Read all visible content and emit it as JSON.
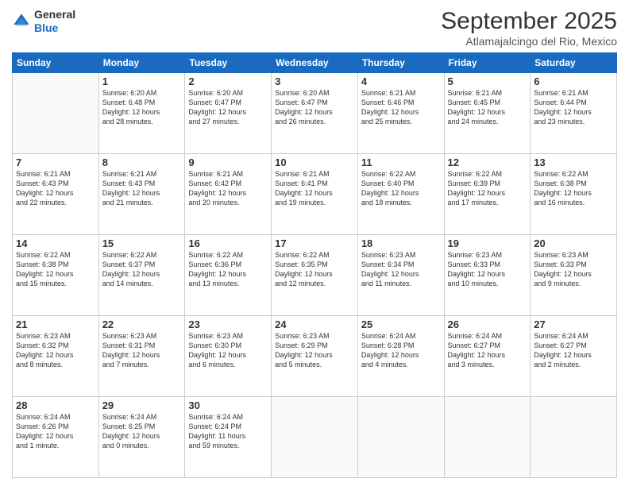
{
  "header": {
    "logo_line1": "General",
    "logo_line2": "Blue",
    "month_title": "September 2025",
    "subtitle": "Atlamajalcingo del Rio, Mexico"
  },
  "days_of_week": [
    "Sunday",
    "Monday",
    "Tuesday",
    "Wednesday",
    "Thursday",
    "Friday",
    "Saturday"
  ],
  "weeks": [
    [
      {
        "num": "",
        "info": ""
      },
      {
        "num": "1",
        "info": "Sunrise: 6:20 AM\nSunset: 6:48 PM\nDaylight: 12 hours\nand 28 minutes."
      },
      {
        "num": "2",
        "info": "Sunrise: 6:20 AM\nSunset: 6:47 PM\nDaylight: 12 hours\nand 27 minutes."
      },
      {
        "num": "3",
        "info": "Sunrise: 6:20 AM\nSunset: 6:47 PM\nDaylight: 12 hours\nand 26 minutes."
      },
      {
        "num": "4",
        "info": "Sunrise: 6:21 AM\nSunset: 6:46 PM\nDaylight: 12 hours\nand 25 minutes."
      },
      {
        "num": "5",
        "info": "Sunrise: 6:21 AM\nSunset: 6:45 PM\nDaylight: 12 hours\nand 24 minutes."
      },
      {
        "num": "6",
        "info": "Sunrise: 6:21 AM\nSunset: 6:44 PM\nDaylight: 12 hours\nand 23 minutes."
      }
    ],
    [
      {
        "num": "7",
        "info": "Sunrise: 6:21 AM\nSunset: 6:43 PM\nDaylight: 12 hours\nand 22 minutes."
      },
      {
        "num": "8",
        "info": "Sunrise: 6:21 AM\nSunset: 6:43 PM\nDaylight: 12 hours\nand 21 minutes."
      },
      {
        "num": "9",
        "info": "Sunrise: 6:21 AM\nSunset: 6:42 PM\nDaylight: 12 hours\nand 20 minutes."
      },
      {
        "num": "10",
        "info": "Sunrise: 6:21 AM\nSunset: 6:41 PM\nDaylight: 12 hours\nand 19 minutes."
      },
      {
        "num": "11",
        "info": "Sunrise: 6:22 AM\nSunset: 6:40 PM\nDaylight: 12 hours\nand 18 minutes."
      },
      {
        "num": "12",
        "info": "Sunrise: 6:22 AM\nSunset: 6:39 PM\nDaylight: 12 hours\nand 17 minutes."
      },
      {
        "num": "13",
        "info": "Sunrise: 6:22 AM\nSunset: 6:38 PM\nDaylight: 12 hours\nand 16 minutes."
      }
    ],
    [
      {
        "num": "14",
        "info": "Sunrise: 6:22 AM\nSunset: 6:38 PM\nDaylight: 12 hours\nand 15 minutes."
      },
      {
        "num": "15",
        "info": "Sunrise: 6:22 AM\nSunset: 6:37 PM\nDaylight: 12 hours\nand 14 minutes."
      },
      {
        "num": "16",
        "info": "Sunrise: 6:22 AM\nSunset: 6:36 PM\nDaylight: 12 hours\nand 13 minutes."
      },
      {
        "num": "17",
        "info": "Sunrise: 6:22 AM\nSunset: 6:35 PM\nDaylight: 12 hours\nand 12 minutes."
      },
      {
        "num": "18",
        "info": "Sunrise: 6:23 AM\nSunset: 6:34 PM\nDaylight: 12 hours\nand 11 minutes."
      },
      {
        "num": "19",
        "info": "Sunrise: 6:23 AM\nSunset: 6:33 PM\nDaylight: 12 hours\nand 10 minutes."
      },
      {
        "num": "20",
        "info": "Sunrise: 6:23 AM\nSunset: 6:33 PM\nDaylight: 12 hours\nand 9 minutes."
      }
    ],
    [
      {
        "num": "21",
        "info": "Sunrise: 6:23 AM\nSunset: 6:32 PM\nDaylight: 12 hours\nand 8 minutes."
      },
      {
        "num": "22",
        "info": "Sunrise: 6:23 AM\nSunset: 6:31 PM\nDaylight: 12 hours\nand 7 minutes."
      },
      {
        "num": "23",
        "info": "Sunrise: 6:23 AM\nSunset: 6:30 PM\nDaylight: 12 hours\nand 6 minutes."
      },
      {
        "num": "24",
        "info": "Sunrise: 6:23 AM\nSunset: 6:29 PM\nDaylight: 12 hours\nand 5 minutes."
      },
      {
        "num": "25",
        "info": "Sunrise: 6:24 AM\nSunset: 6:28 PM\nDaylight: 12 hours\nand 4 minutes."
      },
      {
        "num": "26",
        "info": "Sunrise: 6:24 AM\nSunset: 6:27 PM\nDaylight: 12 hours\nand 3 minutes."
      },
      {
        "num": "27",
        "info": "Sunrise: 6:24 AM\nSunset: 6:27 PM\nDaylight: 12 hours\nand 2 minutes."
      }
    ],
    [
      {
        "num": "28",
        "info": "Sunrise: 6:24 AM\nSunset: 6:26 PM\nDaylight: 12 hours\nand 1 minute."
      },
      {
        "num": "29",
        "info": "Sunrise: 6:24 AM\nSunset: 6:25 PM\nDaylight: 12 hours\nand 0 minutes."
      },
      {
        "num": "30",
        "info": "Sunrise: 6:24 AM\nSunset: 6:24 PM\nDaylight: 11 hours\nand 59 minutes."
      },
      {
        "num": "",
        "info": ""
      },
      {
        "num": "",
        "info": ""
      },
      {
        "num": "",
        "info": ""
      },
      {
        "num": "",
        "info": ""
      }
    ]
  ]
}
